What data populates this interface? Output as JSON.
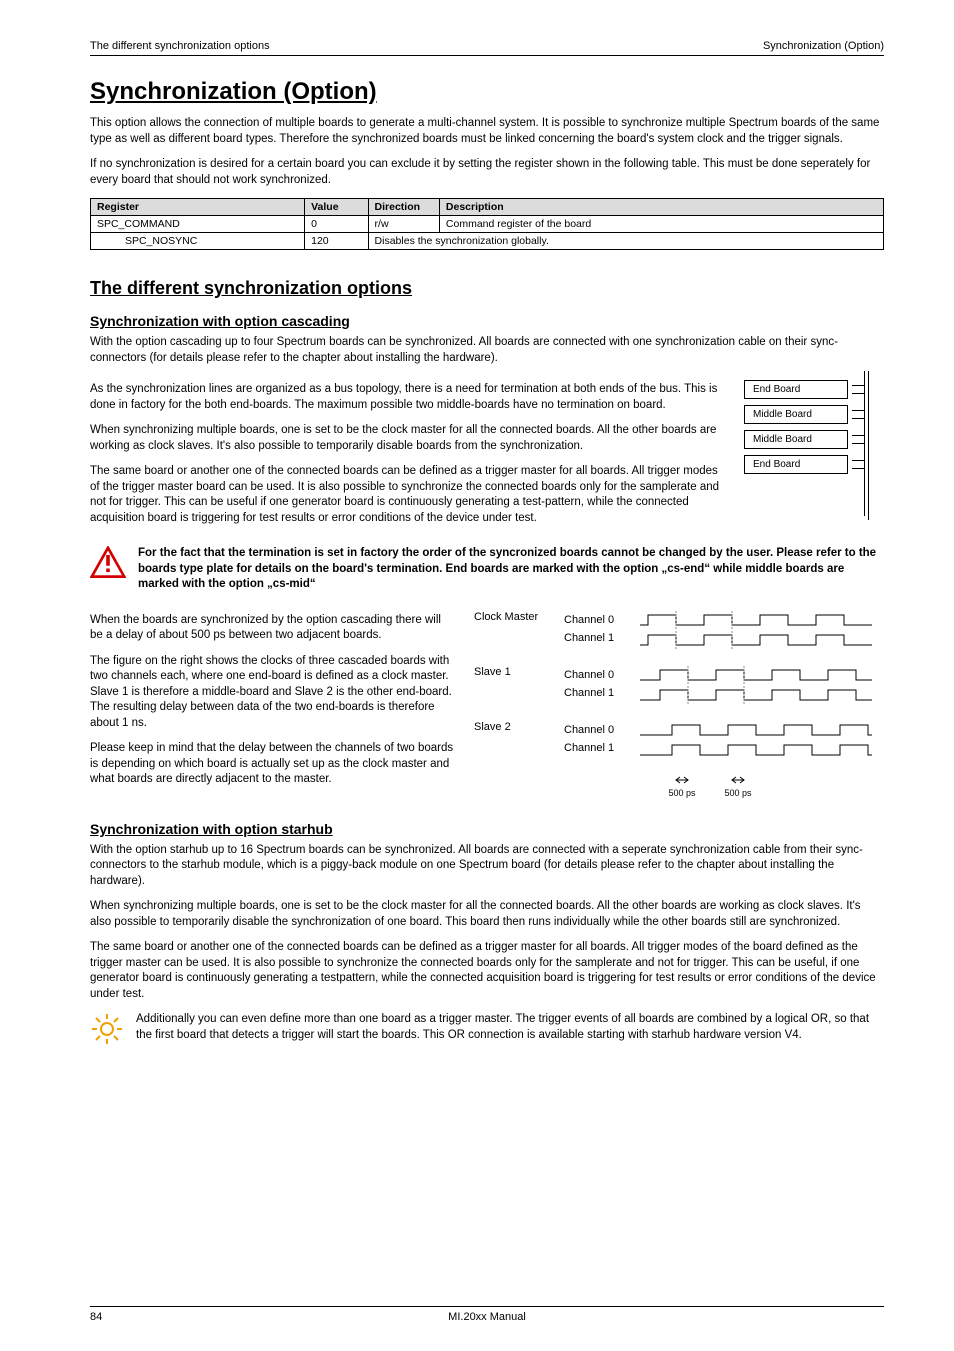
{
  "runhead": {
    "left": "The different synchronization options",
    "right": "Synchronization (Option)"
  },
  "title": "Synchronization (Option)",
  "intro1": "This option allows the connection of multiple boards to generate a multi-channel system. It is possible to synchronize multiple Spectrum boards of the same type as well as different board types. Therefore the synchronized boards must be linked concerning the board's system clock and the trigger signals.",
  "intro2": "If no synchronization is desired for a certain board you can exclude it by setting the register shown in the following table. This must be done seperately for every board that should not work synchronized.",
  "reg_table": {
    "header": {
      "c1": "Register",
      "c2": "Value",
      "c3": "Direction",
      "c4": "Description"
    },
    "row1": {
      "c1": "SPC_COMMAND",
      "c2": "0",
      "c3": "r/w",
      "c4": "Command register of the board"
    },
    "row2": {
      "c1": "SPC_NOSYNC",
      "c2": "120",
      "c4": "Disables the synchronization globally."
    }
  },
  "h2_options": "The different synchronization options",
  "h3_cascading": "Synchronization with option cascading",
  "casc": {
    "p1": "With the option cascading up to four Spectrum boards can be synchronized. All boards are connected with one synchronization cable on their sync-connectors (for details please refer to the chapter about installing the hardware).",
    "p2": "As the synchronization lines are organized as a bus topology, there is a need for termination at both ends of the bus. This is done in factory for the both end-boards. The maximum possible two middle-boards have no termination on board.",
    "p3": "When synchronizing multiple boards, one is set to be the clock master for all the connected boards. All the other boards are working as clock slaves. It's also possible to temporarily disable boards from the synchronization.",
    "p4": "The same board or another one of the connected boards can be defined as a trigger master for all boards. All trigger modes of the trigger master board can be used. It is also possible to synchronize the connected boards only for the samplerate and not for trigger. This can be useful if one generator board is continuously generating a test-pattern, while the connected acquisition board is triggering for test results or error conditions of the device under test.",
    "diagram": {
      "b1": "End Board",
      "b2": "Middle Board",
      "b3": "Middle Board",
      "b4": "End Board"
    },
    "warning": "For the fact that the termination is set in factory the order of the syncronized boards cannot be changed by the user. Please refer to the boards type plate for details on the board's termination. End boards are marked with the option „cs-end“ while middle boards are marked with the option „cs-mid“",
    "delay1": "When the boards are synchronized by the option cascading there will be a delay of about 500 ps between two adjacent boards.",
    "delay2": "The figure on the right shows the clocks of three cascaded boards with two channels each, where one end-board is defined as a clock master. Slave 1 is therefore a middle-board and Slave 2 is the other end-board. The resulting delay between data of the two end-boards is therefore about 1 ns.",
    "delay3": "Please keep in mind that the delay between the channels of two boards is depending on which board is actually set up as the clock master and what boards are directly adjacent to the master."
  },
  "clockfig": {
    "r1_label": "Clock Master",
    "r2_label": "Slave 1",
    "r3_label": "Slave 2",
    "ch0": "Channel 0",
    "ch1": "Channel 1",
    "t1": "500 ps",
    "t2": "500 ps"
  },
  "h3_starhub": "Synchronization with option starhub",
  "starhub": {
    "p1": "With the option starhub up to 16 Spectrum boards can be synchronized. All boards are connected with a seperate synchronization cable from their sync-connectors to the starhub module, which is a piggy-back module on one Spectrum board (for details please refer to the chapter about installing the hardware).",
    "p2": "When synchronizing multiple boards, one is set to be the clock master for all the connected boards. All the other boards are working as clock slaves. It's also possible to temporarily disable the synchronization of one board. This board then runs individually while the other boards still are synchronized.",
    "p3": "The same board or another one of the connected boards can be defined as a trigger master for all boards. All trigger modes of the board defined as the trigger master can be used. It is also possible to synchronize the connected boards only for the samplerate and not for trigger. This can be useful, if one generator board is continuously generating a testpattern, while the connected acquisition board is triggering for test results or error conditions of the device under test.",
    "info": "Additionally you can even define more than one board as a trigger master. The trigger events of all boards are combined by a logical OR, so that the first board that detects a trigger will start the boards. This OR connection is available starting with starhub hardware version V4."
  },
  "footer": {
    "page": "84",
    "center": "MI.20xx Manual"
  }
}
